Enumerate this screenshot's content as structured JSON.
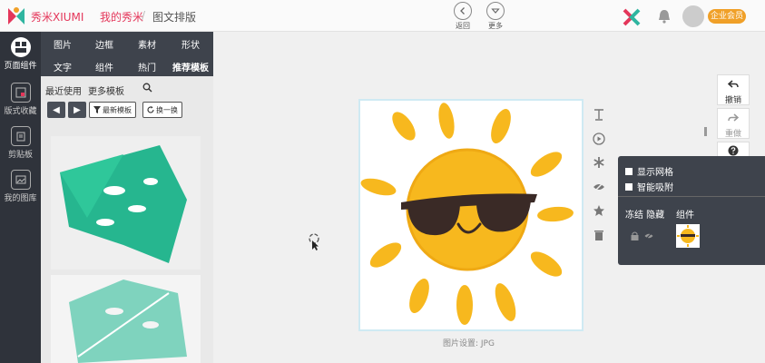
{
  "header": {
    "brand": "秀米XIUMI",
    "nav_mine": "我的秀米",
    "nav_sep": "/",
    "nav_current": "图文排版",
    "back_label": "返回",
    "more_label": "更多",
    "vip_badge": "企业会员"
  },
  "icon_sidebar": {
    "items": [
      {
        "label": "页面组件"
      },
      {
        "label": "版式收藏"
      },
      {
        "label": "剪贴板"
      },
      {
        "label": "我的图库"
      }
    ]
  },
  "panel": {
    "tabs_row1": [
      "图片",
      "边框",
      "素材",
      "形状"
    ],
    "tabs_row2": [
      "文字",
      "组件",
      "热门",
      "推荐模板"
    ],
    "subtabs": [
      "最近使用",
      "更多模板"
    ],
    "filter_label": "最新模板",
    "shuffle_label": "换一换"
  },
  "canvas": {
    "caption": "图片设置: JPG"
  },
  "right_tools": {
    "undo_label": "撤销",
    "redo_label": "重做"
  },
  "layers": {
    "show_grid": "显示网格",
    "smart_snap": "智能吸附",
    "col_freeze_hide": "冻结 隐藏",
    "col_component": "组件"
  },
  "colors": {
    "sidebar_dark": "#2f333b",
    "panel_dark": "#3e434c",
    "brand_red": "#e4365a",
    "sun_yellow": "#f7b81e",
    "leaf_green": "#26b68f"
  }
}
